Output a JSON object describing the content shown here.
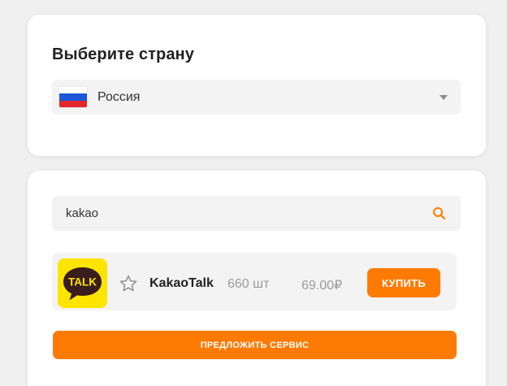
{
  "country_section": {
    "title": "Выберите страну",
    "selected_country": "Россия",
    "flag": "russia-flag",
    "dropdown_icon": "caret-down-icon"
  },
  "search": {
    "value": "kakao",
    "icon": "search-icon"
  },
  "services": [
    {
      "logo_text": "TALK",
      "name": "KakaoTalk",
      "count": "660 шт",
      "price": "69.00₽",
      "favorite_icon": "star-outline-icon",
      "buy_label": "КУПИТЬ",
      "logo_color": "#fee500"
    }
  ],
  "suggest_button": {
    "label": "ПРЕДЛОЖИТЬ СЕРВИС"
  },
  "colors": {
    "accent": "#ff7a00",
    "background": "#f0f0f0",
    "card": "#ffffff",
    "field": "#f3f3f3"
  }
}
